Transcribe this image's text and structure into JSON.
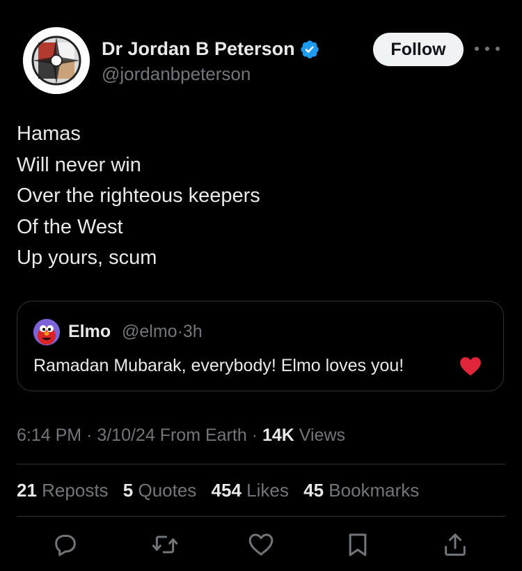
{
  "author": {
    "name": "Dr Jordan B Peterson",
    "handle": "@jordanbpeterson",
    "verified": true
  },
  "follow_label": "Follow",
  "tweet": {
    "lines": [
      "Hamas",
      "Will never win",
      "Over the righteous keepers",
      "Of the West",
      "Up yours, scum"
    ]
  },
  "quote": {
    "name": "Elmo",
    "handle": "@elmo",
    "sep": "·",
    "age": "3h",
    "text": "Ramadan Mubarak, everybody! Elmo loves you!",
    "emoji": "red-heart-emoji"
  },
  "meta": {
    "time": "6:14 PM",
    "date": "3/10/24",
    "source": "From Earth",
    "views_count": "14K",
    "views_label": "Views"
  },
  "stats": {
    "reposts_count": "21",
    "reposts_label": "Reposts",
    "quotes_count": "5",
    "quotes_label": "Quotes",
    "likes_count": "454",
    "likes_label": "Likes",
    "bookmarks_count": "45",
    "bookmarks_label": "Bookmarks"
  },
  "actions": [
    "reply-icon",
    "repost-icon",
    "like-icon",
    "bookmark-icon",
    "share-icon"
  ],
  "colors": {
    "background": "#000000",
    "text": "#e7e9ea",
    "secondary": "#71767b",
    "verified": "#1d9bf0",
    "divider": "#2f3336",
    "follow_bg": "#eff3f4"
  }
}
